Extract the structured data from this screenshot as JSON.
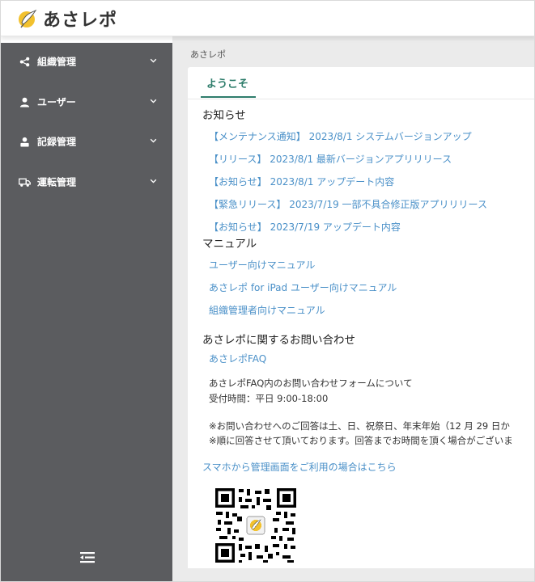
{
  "app": {
    "title": "あさレポ"
  },
  "sidebar": {
    "items": [
      {
        "label": "組織管理",
        "icon": "share-icon"
      },
      {
        "label": "ユーザー",
        "icon": "user-icon"
      },
      {
        "label": "記録管理",
        "icon": "record-user-icon"
      },
      {
        "label": "運転管理",
        "icon": "truck-icon"
      }
    ],
    "collapse_icon": "collapse-menu-icon"
  },
  "breadcrumb": "あさレポ",
  "tabs": [
    {
      "label": "ようこそ",
      "active": true
    }
  ],
  "news": {
    "title": "お知らせ",
    "items": [
      "【メンテナンス通知】 2023/8/1 システムバージョンアップ",
      "【リリース】 2023/8/1 最新バージョンアプリリリース",
      "【お知らせ】 2023/8/1 アップデート内容",
      "【緊急リリース】 2023/7/19 一部不具合修正版アプリリリース",
      "【お知らせ】 2023/7/19 アップデート内容"
    ]
  },
  "manual": {
    "title": "マニュアル",
    "items": [
      "ユーザー向けマニュアル",
      "あさレポ for iPad ユーザー向けマニュアル",
      "組織管理者向けマニュアル"
    ]
  },
  "contact": {
    "title": "あさレポに関するお問い合わせ",
    "faq_link": "あさレポFAQ",
    "form_text": "あさレポFAQ内のお問い合わせフォームについて",
    "hours": "受付時間：平日 9:00-18:00",
    "note1": "※お問い合わせへのご回答は土、日、祝祭日、年末年始（12 月 29 日か",
    "note2": "※順に回答させて頂いております。回答までお時間を頂く場合がございま"
  },
  "smartphone_link": "スマホから管理画面をご利用の場合はこちら",
  "colors": {
    "sidebar_bg": "#5b5c5f",
    "accent": "#2e7d6b",
    "link": "#4a90c8",
    "content_bg": "#ebebeb"
  }
}
